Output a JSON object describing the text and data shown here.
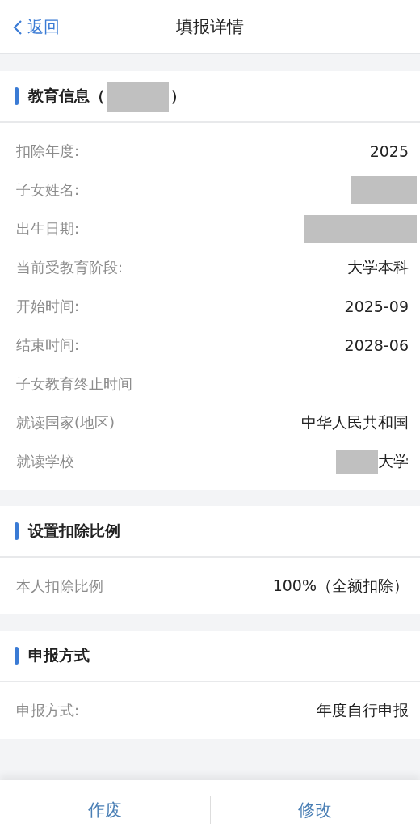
{
  "nav": {
    "back": "返回",
    "title": "填报详情"
  },
  "sections": [
    {
      "title": "教育信息（",
      "title_redacted": true,
      "title_tail": "）",
      "rows": [
        {
          "label": "扣除年度:",
          "kind": "text",
          "value": "2025"
        },
        {
          "label": "子女姓名:",
          "kind": "redacted"
        },
        {
          "label": "出生日期:",
          "kind": "redacted_wide"
        },
        {
          "label": "当前受教育阶段:",
          "kind": "text",
          "value": "大学本科"
        },
        {
          "label": "开始时间:",
          "kind": "text",
          "value": "2025-09"
        },
        {
          "label": "结束时间:",
          "kind": "text",
          "value": "2028-06"
        },
        {
          "label": "子女教育终止时间",
          "kind": "empty"
        },
        {
          "label": "就读国家(地区)",
          "kind": "text",
          "value": "中华人民共和国"
        },
        {
          "label": "就读学校",
          "kind": "partly_redacted",
          "value": "大学"
        }
      ]
    },
    {
      "title": "设置扣除比例",
      "title_redacted": false,
      "rows": [
        {
          "label": "本人扣除比例",
          "kind": "text",
          "value": "100%（全额扣除）"
        }
      ]
    },
    {
      "title": "申报方式",
      "title_redacted": false,
      "rows": [
        {
          "label": "申报方式:",
          "kind": "text",
          "value": "年度自行申报"
        }
      ]
    }
  ],
  "footer": {
    "buttons": [
      "作废",
      "修改"
    ]
  }
}
